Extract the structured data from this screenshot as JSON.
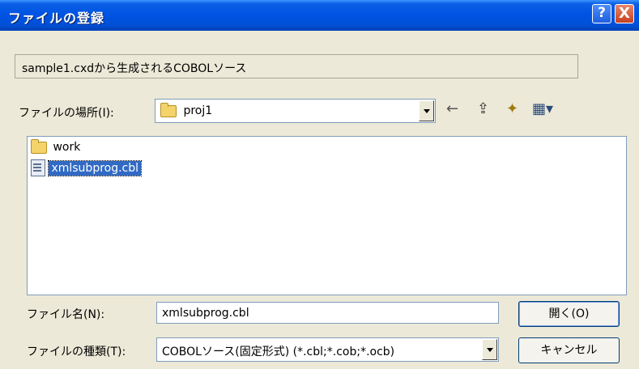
{
  "window": {
    "title": "ファイルの登録",
    "help_glyph": "?",
    "close_glyph": "X"
  },
  "caption": "sample1.cxdから生成されるCOBOLソース",
  "location": {
    "label": "ファイルの場所(I):",
    "value": "proj1"
  },
  "toolbar": {
    "back_icon": "back-arrow-icon",
    "up_icon": "up-folder-icon",
    "new_folder_icon": "new-folder-icon",
    "view_icon": "view-menu-icon"
  },
  "files": [
    {
      "name": "work",
      "type": "folder",
      "selected": false
    },
    {
      "name": "xmlsubprog.cbl",
      "type": "file",
      "selected": true
    }
  ],
  "filename": {
    "label": "ファイル名(N):",
    "value": "xmlsubprog.cbl"
  },
  "filetype": {
    "label": "ファイルの種類(T):",
    "value": "COBOLソース(固定形式) (*.cbl;*.cob;*.ocb)"
  },
  "buttons": {
    "open": "開く(O)",
    "cancel": "キャンセル"
  },
  "colors": {
    "titlebar": "#0054e3",
    "selection": "#316ac5",
    "dialog_bg": "#ece9d8"
  }
}
